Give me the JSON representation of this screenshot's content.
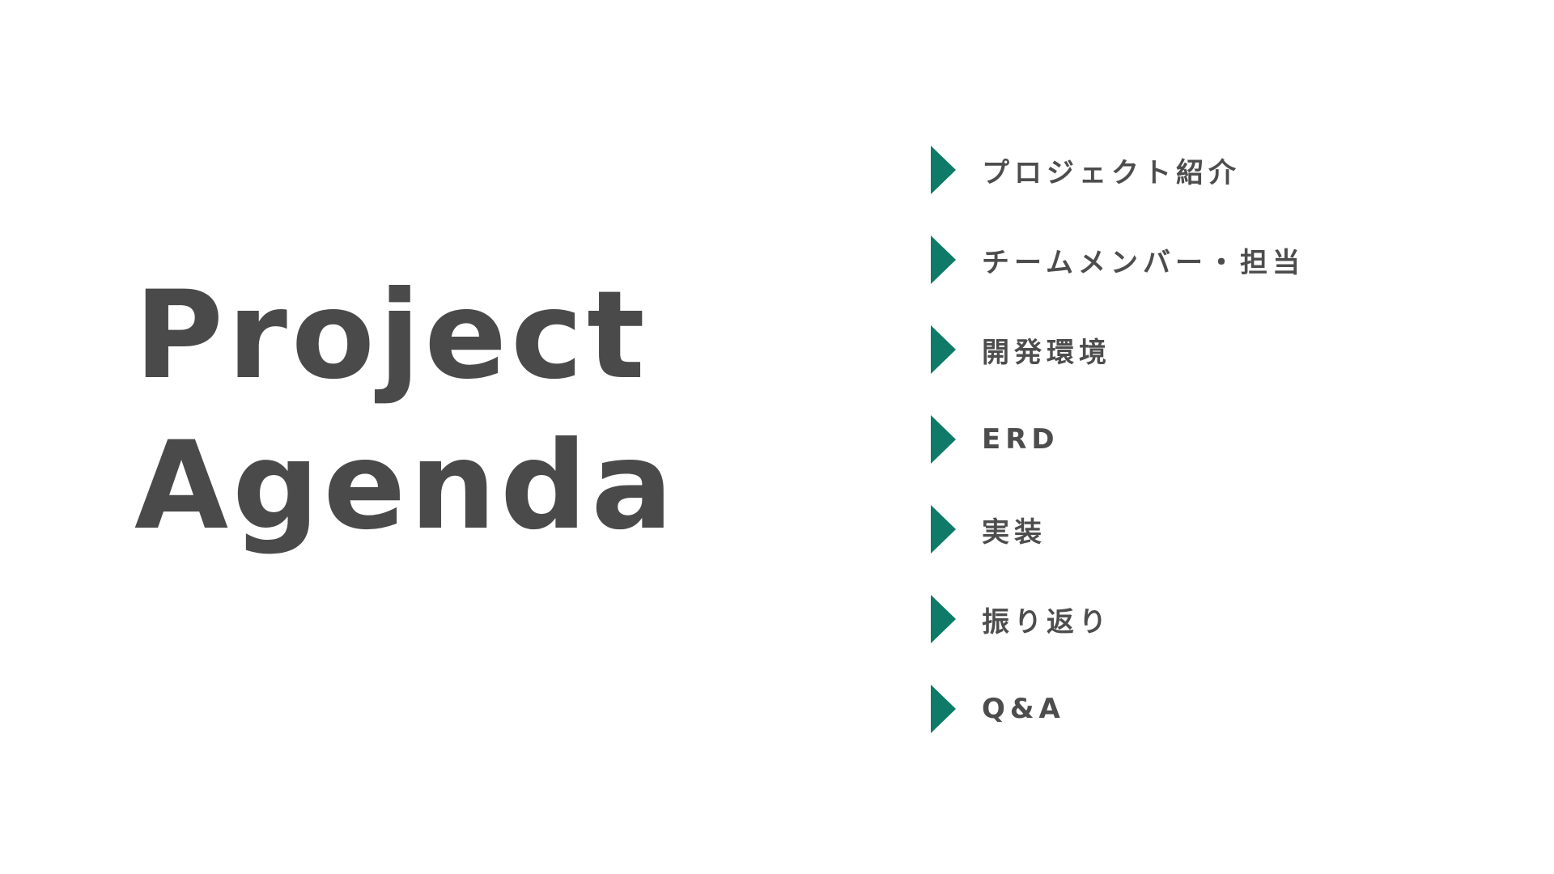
{
  "slide": {
    "title_line1": "Project",
    "title_line2": "Agenda",
    "accent_color": "#0e7a67",
    "text_color": "#4a4a4a",
    "marker_icon": "play-triangle-icon",
    "agenda": [
      {
        "label": "プロジェクト紹介"
      },
      {
        "label": "チームメンバー・担当"
      },
      {
        "label": "開発環境"
      },
      {
        "label": "ERD"
      },
      {
        "label": "実装"
      },
      {
        "label": "振り返り"
      },
      {
        "label": "Q&A"
      }
    ]
  }
}
